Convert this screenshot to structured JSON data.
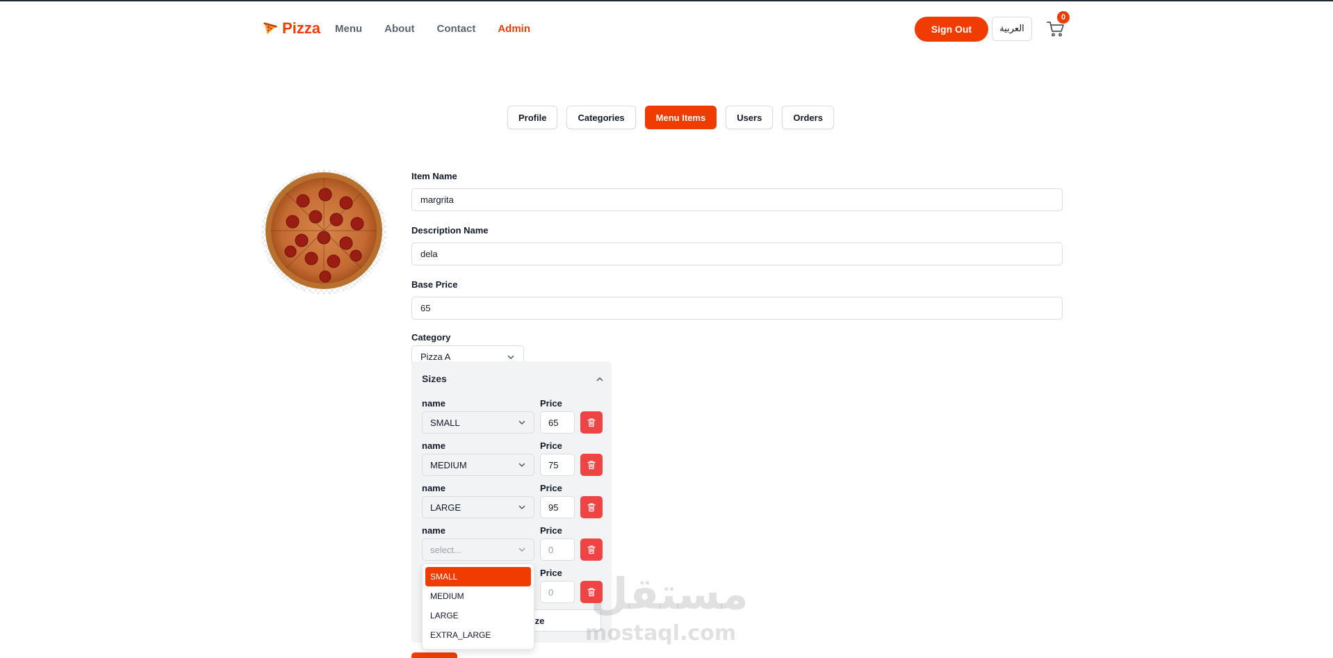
{
  "header": {
    "logo_text": "Pizza",
    "nav": [
      {
        "label": "Menu"
      },
      {
        "label": "About"
      },
      {
        "label": "Contact"
      },
      {
        "label": "Admin",
        "active": true
      }
    ],
    "sign_out_label": "Sign Out",
    "language_label": "العربية",
    "cart_count": "0"
  },
  "tabs": [
    {
      "label": "Profile"
    },
    {
      "label": "Categories"
    },
    {
      "label": "Menu Items",
      "active": true
    },
    {
      "label": "Users"
    },
    {
      "label": "Orders"
    }
  ],
  "form": {
    "item_name": {
      "label": "Item Name",
      "value": "margrita"
    },
    "description": {
      "label": "Description Name",
      "value": "dela"
    },
    "base_price": {
      "label": "Base Price",
      "value": "65"
    },
    "category": {
      "label": "Category",
      "value": "Pizza A"
    }
  },
  "sizes": {
    "title": "Sizes",
    "name_label": "name",
    "price_label": "Price",
    "rows": [
      {
        "name": "SMALL",
        "price": "65"
      },
      {
        "name": "MEDIUM",
        "price": "75"
      },
      {
        "name": "LARGE",
        "price": "95"
      },
      {
        "name_placeholder": "select...",
        "price_placeholder": "0"
      },
      {
        "price_placeholder": "0"
      }
    ],
    "add_button_label": "ize",
    "dropdown_options": [
      "SMALL",
      "MEDIUM",
      "LARGE",
      "EXTRA_LARGE"
    ],
    "dropdown_highlighted": "SMALL"
  },
  "watermark": {
    "arabic": "مستقل",
    "latin": "mostaql.com"
  },
  "colors": {
    "accent": "#f03c00",
    "danger": "#ef4444",
    "panel_bg": "#f2f3f5"
  }
}
